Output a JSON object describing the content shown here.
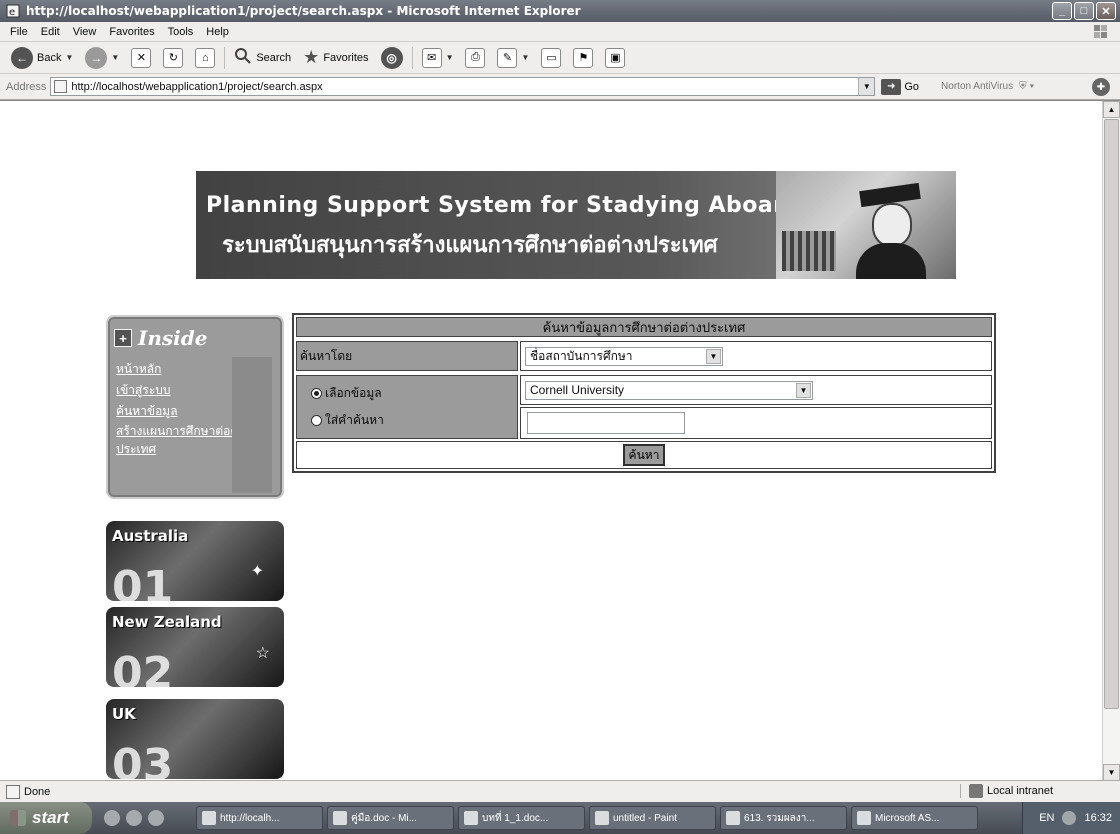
{
  "window": {
    "title": "http://localhost/webapplication1/project/search.aspx - Microsoft Internet Explorer",
    "icon": "ie-icon",
    "controls": [
      "minimize",
      "maximize",
      "close"
    ]
  },
  "menu": [
    "File",
    "Edit",
    "View",
    "Favorites",
    "Tools",
    "Help"
  ],
  "toolbar": {
    "back_label": "Back",
    "search_label": "Search",
    "favorites_label": "Favorites"
  },
  "address": {
    "label": "Address",
    "url": "http://localhost/webapplication1/project/search.aspx",
    "go_label": "Go",
    "norton_label": "Norton AntiVirus"
  },
  "page": {
    "banner_en": "Planning Support System for Stadying Aboard",
    "banner_th": "ระบบสนับสนุนการสร้างแผนการศึกษาต่อต่างประเทศ",
    "side_menu": {
      "title": "Inside",
      "links": [
        "หน้าหลัก",
        "เข้าสู่ระบบ",
        "ค้นหาข้อมูล",
        "สร้างแผนการศึกษาต่อต่างประเทศ"
      ]
    },
    "countries": [
      {
        "name": "Australia",
        "number": "01"
      },
      {
        "name": "New Zealand",
        "number": "02"
      },
      {
        "name": "UK",
        "number": "03"
      }
    ],
    "search_form": {
      "title": "ค้นหาข้อมูลการศึกษาต่อต่างประเทศ",
      "search_by_label": "ค้นหาโดย",
      "search_by_value": "ชื่อสถาบันการศึกษา",
      "radio_select_label": "เลือกข้อมูล",
      "radio_keyword_label": "ใส่คำค้นหา",
      "selected_option": "Cornell University",
      "keyword_value": "",
      "search_button": "ค้นหา"
    }
  },
  "status": {
    "text": "Done",
    "zone": "Local intranet"
  },
  "taskbar": {
    "start_label": "start",
    "tasks": [
      "http://localh...",
      "คู่มือ.doc - Mi...",
      "บทที่ 1_1.doc...",
      "untitled - Paint",
      "613. รวมผลงา...",
      "Microsoft AS..."
    ],
    "language": "EN",
    "clock": "16:32"
  }
}
